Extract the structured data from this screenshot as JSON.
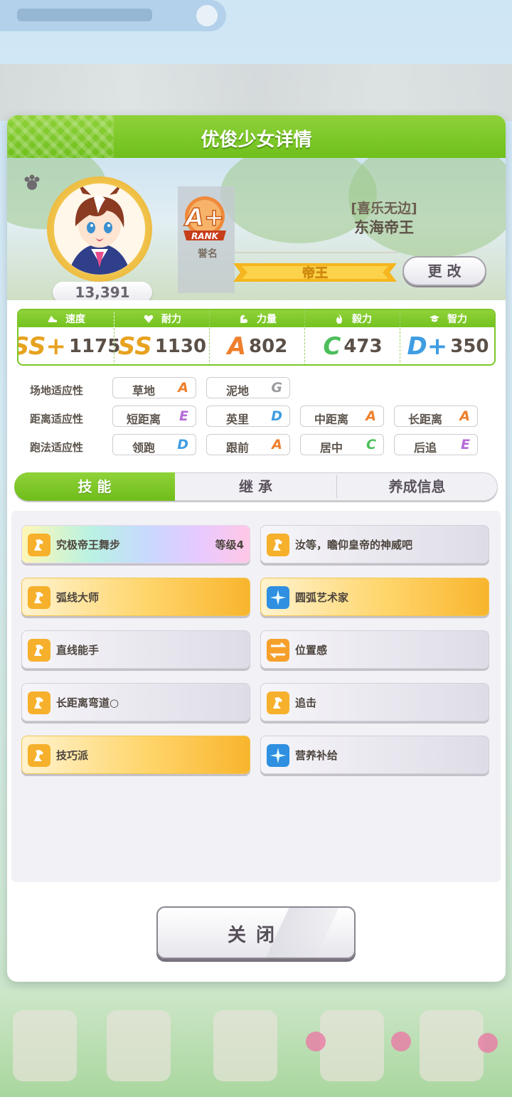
{
  "dialog": {
    "title": "优俊少女详情"
  },
  "profile": {
    "fan_count": "13,391",
    "rank_grade": "A+",
    "rank_word": "RANK",
    "fame_label": "誉名",
    "nickname": "[喜乐无边]",
    "name": "东海帝王",
    "title_ribbon": "帝王",
    "change_label": "更 改"
  },
  "stats": [
    {
      "label": "速度",
      "grade": "SS+",
      "value": "1175",
      "color": "#e7a21f",
      "icon": "shoe-icon"
    },
    {
      "label": "耐力",
      "grade": "SS",
      "value": "1130",
      "color": "#e7a21f",
      "icon": "heart-icon"
    },
    {
      "label": "力量",
      "grade": "A",
      "value": "802",
      "color": "#ee7f2c",
      "icon": "muscle-icon"
    },
    {
      "label": "毅力",
      "grade": "C",
      "value": "473",
      "color": "#4cbf5a",
      "icon": "fire-icon"
    },
    {
      "label": "智力",
      "grade": "D+",
      "value": "350",
      "color": "#3f9de2",
      "icon": "cap-icon"
    }
  ],
  "aptitude": {
    "track": {
      "label": "场地适应性",
      "items": [
        {
          "name": "草地",
          "grade": "A"
        },
        {
          "name": "泥地",
          "grade": "G"
        }
      ]
    },
    "distance": {
      "label": "距离适应性",
      "items": [
        {
          "name": "短距离",
          "grade": "E"
        },
        {
          "name": "英里",
          "grade": "D"
        },
        {
          "name": "中距离",
          "grade": "A"
        },
        {
          "name": "长距离",
          "grade": "A"
        }
      ]
    },
    "strategy": {
      "label": "跑法适应性",
      "items": [
        {
          "name": "领跑",
          "grade": "D"
        },
        {
          "name": "跟前",
          "grade": "A"
        },
        {
          "name": "居中",
          "grade": "C"
        },
        {
          "name": "后追",
          "grade": "E"
        }
      ]
    }
  },
  "grade_colors": {
    "A": "#ee7f2c",
    "C": "#4cbf5a",
    "D": "#3f9de2",
    "E": "#b56ad8",
    "G": "#9a9aa0"
  },
  "tabs": [
    {
      "label": "技 能",
      "active": true
    },
    {
      "label": "继 承",
      "active": false
    },
    {
      "label": "养成信息",
      "active": false
    }
  ],
  "skills": [
    {
      "name": "究极帝王舞步",
      "level": "等级4",
      "style": "rainbow",
      "icon": "horse-icon"
    },
    {
      "name": "汝等，瞻仰皇帝的神威吧",
      "level": "",
      "style": "grey",
      "icon": "horse-icon"
    },
    {
      "name": "弧线大师",
      "level": "",
      "style": "gold",
      "icon": "horse-icon"
    },
    {
      "name": "圆弧艺术家",
      "level": "",
      "style": "gold",
      "icon": "sparkle-icon"
    },
    {
      "name": "直线能手",
      "level": "",
      "style": "grey",
      "icon": "horse-icon"
    },
    {
      "name": "位置感",
      "level": "",
      "style": "grey",
      "icon": "position-icon"
    },
    {
      "name": "长距离弯道○",
      "level": "",
      "style": "grey",
      "icon": "horse-icon"
    },
    {
      "name": "追击",
      "level": "",
      "style": "grey",
      "icon": "horse-icon"
    },
    {
      "name": "技巧派",
      "level": "",
      "style": "gold",
      "icon": "horse-icon"
    },
    {
      "name": "营养补给",
      "level": "",
      "style": "grey",
      "icon": "sparkle-icon"
    }
  ],
  "close_label": "关闭"
}
